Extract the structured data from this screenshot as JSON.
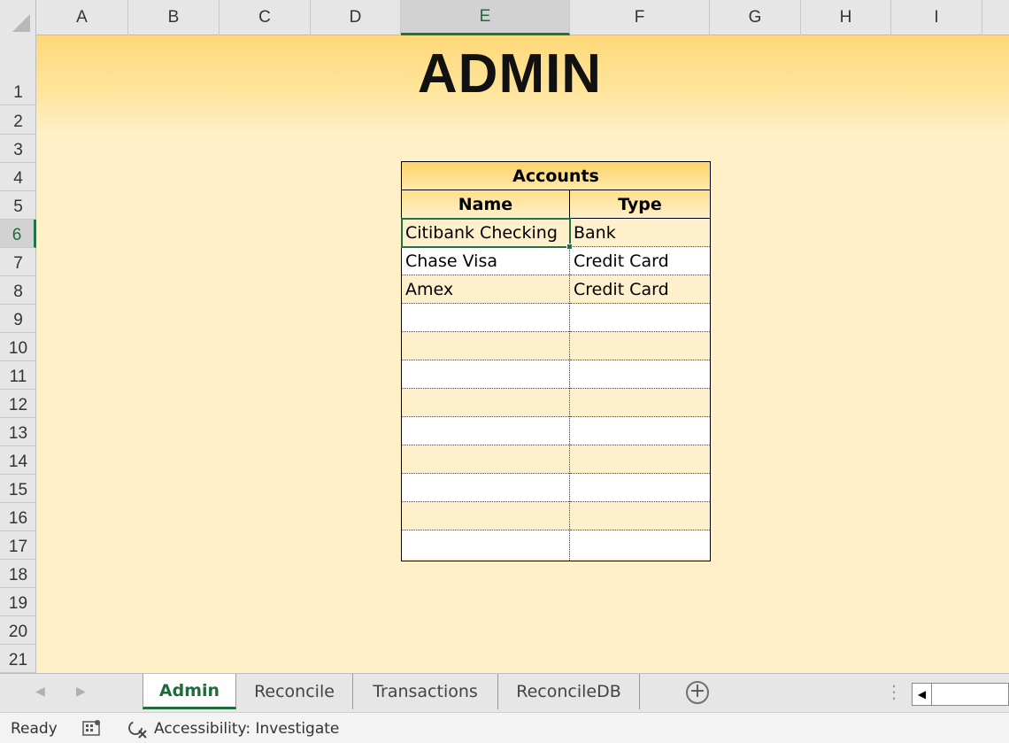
{
  "columns": [
    "A",
    "B",
    "C",
    "D",
    "E",
    "F",
    "G",
    "H",
    "I"
  ],
  "rows": [
    "1",
    "2",
    "3",
    "4",
    "5",
    "6",
    "7",
    "8",
    "9",
    "10",
    "11",
    "12",
    "13",
    "14",
    "15",
    "16",
    "17",
    "18",
    "19",
    "20",
    "21"
  ],
  "sheet": {
    "title": "ADMIN"
  },
  "accounts": {
    "header": "Accounts",
    "col_name": "Name",
    "col_type": "Type",
    "rows": [
      {
        "name": "Citibank Checking",
        "type": "Bank"
      },
      {
        "name": "Chase Visa",
        "type": "Credit Card"
      },
      {
        "name": "Amex",
        "type": "Credit Card"
      },
      {
        "name": "",
        "type": ""
      },
      {
        "name": "",
        "type": ""
      },
      {
        "name": "",
        "type": ""
      },
      {
        "name": "",
        "type": ""
      },
      {
        "name": "",
        "type": ""
      },
      {
        "name": "",
        "type": ""
      },
      {
        "name": "",
        "type": ""
      },
      {
        "name": "",
        "type": ""
      },
      {
        "name": "",
        "type": ""
      }
    ]
  },
  "tabs": [
    "Admin",
    "Reconcile",
    "Transactions",
    "ReconcileDB"
  ],
  "add_sheet": "+",
  "status": {
    "ready": "Ready",
    "accessibility": "Accessibility: Investigate"
  },
  "colors": {
    "accent": "#217346",
    "sheet_bg": "#fff0c8",
    "banner": "#ffd979"
  }
}
